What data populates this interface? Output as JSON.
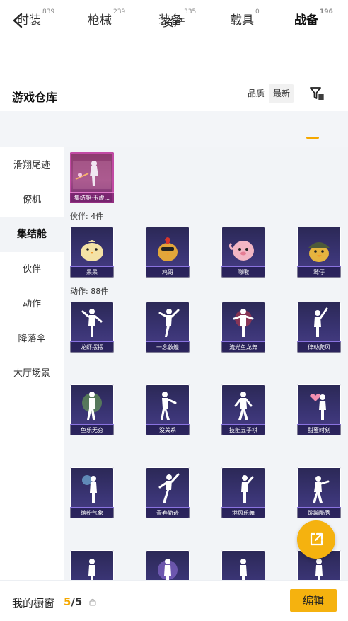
{
  "header": {
    "title": "资产"
  },
  "warehouse": {
    "title": "游戏仓库",
    "sort_options": [
      "品质",
      "最新"
    ],
    "sort_selected": "品质"
  },
  "tabs": [
    {
      "label": "时装",
      "count": "839"
    },
    {
      "label": "枪械",
      "count": "239"
    },
    {
      "label": "装备",
      "count": "335"
    },
    {
      "label": "载具",
      "count": "0"
    },
    {
      "label": "战备",
      "count": "196"
    }
  ],
  "active_tab": "战备",
  "sidebar": [
    {
      "label": "滑翔尾迹"
    },
    {
      "label": "僚机"
    },
    {
      "label": "集结舱"
    },
    {
      "label": "伙伴"
    },
    {
      "label": "动作"
    },
    {
      "label": "降落伞"
    },
    {
      "label": "大厅场景"
    }
  ],
  "active_sidebar": "集结舱",
  "featured_item": {
    "label": "集结舱·玉虚..."
  },
  "groups": {
    "partners": {
      "label": "伙伴: 4件",
      "items": [
        "呆呆",
        "鸡哥",
        "啾啾",
        "鹜仔"
      ]
    },
    "actions": {
      "label": "动作: 88件",
      "items": [
        "龙虾摆摆",
        "一念敦煌",
        "流光鱼龙舞",
        "律动爬风",
        "鱼乐无穷",
        "没关系",
        "技能五子棋",
        "甜蜜时刻",
        "缤纷气象",
        "青春轨迹",
        "港风乐舞",
        "蹦蹦酷秀",
        "",
        "",
        "",
        ""
      ]
    }
  },
  "bottom": {
    "showcase_label": "我的橱窗",
    "count_current": "5",
    "count_total": "/5",
    "edit_label": "编辑"
  },
  "colors": {
    "accent": "#f5b20f",
    "card_bg": "#3b3576"
  },
  "icons": [
    "back-arrow-icon",
    "filter-icon",
    "share-out-icon",
    "lock-icon"
  ]
}
